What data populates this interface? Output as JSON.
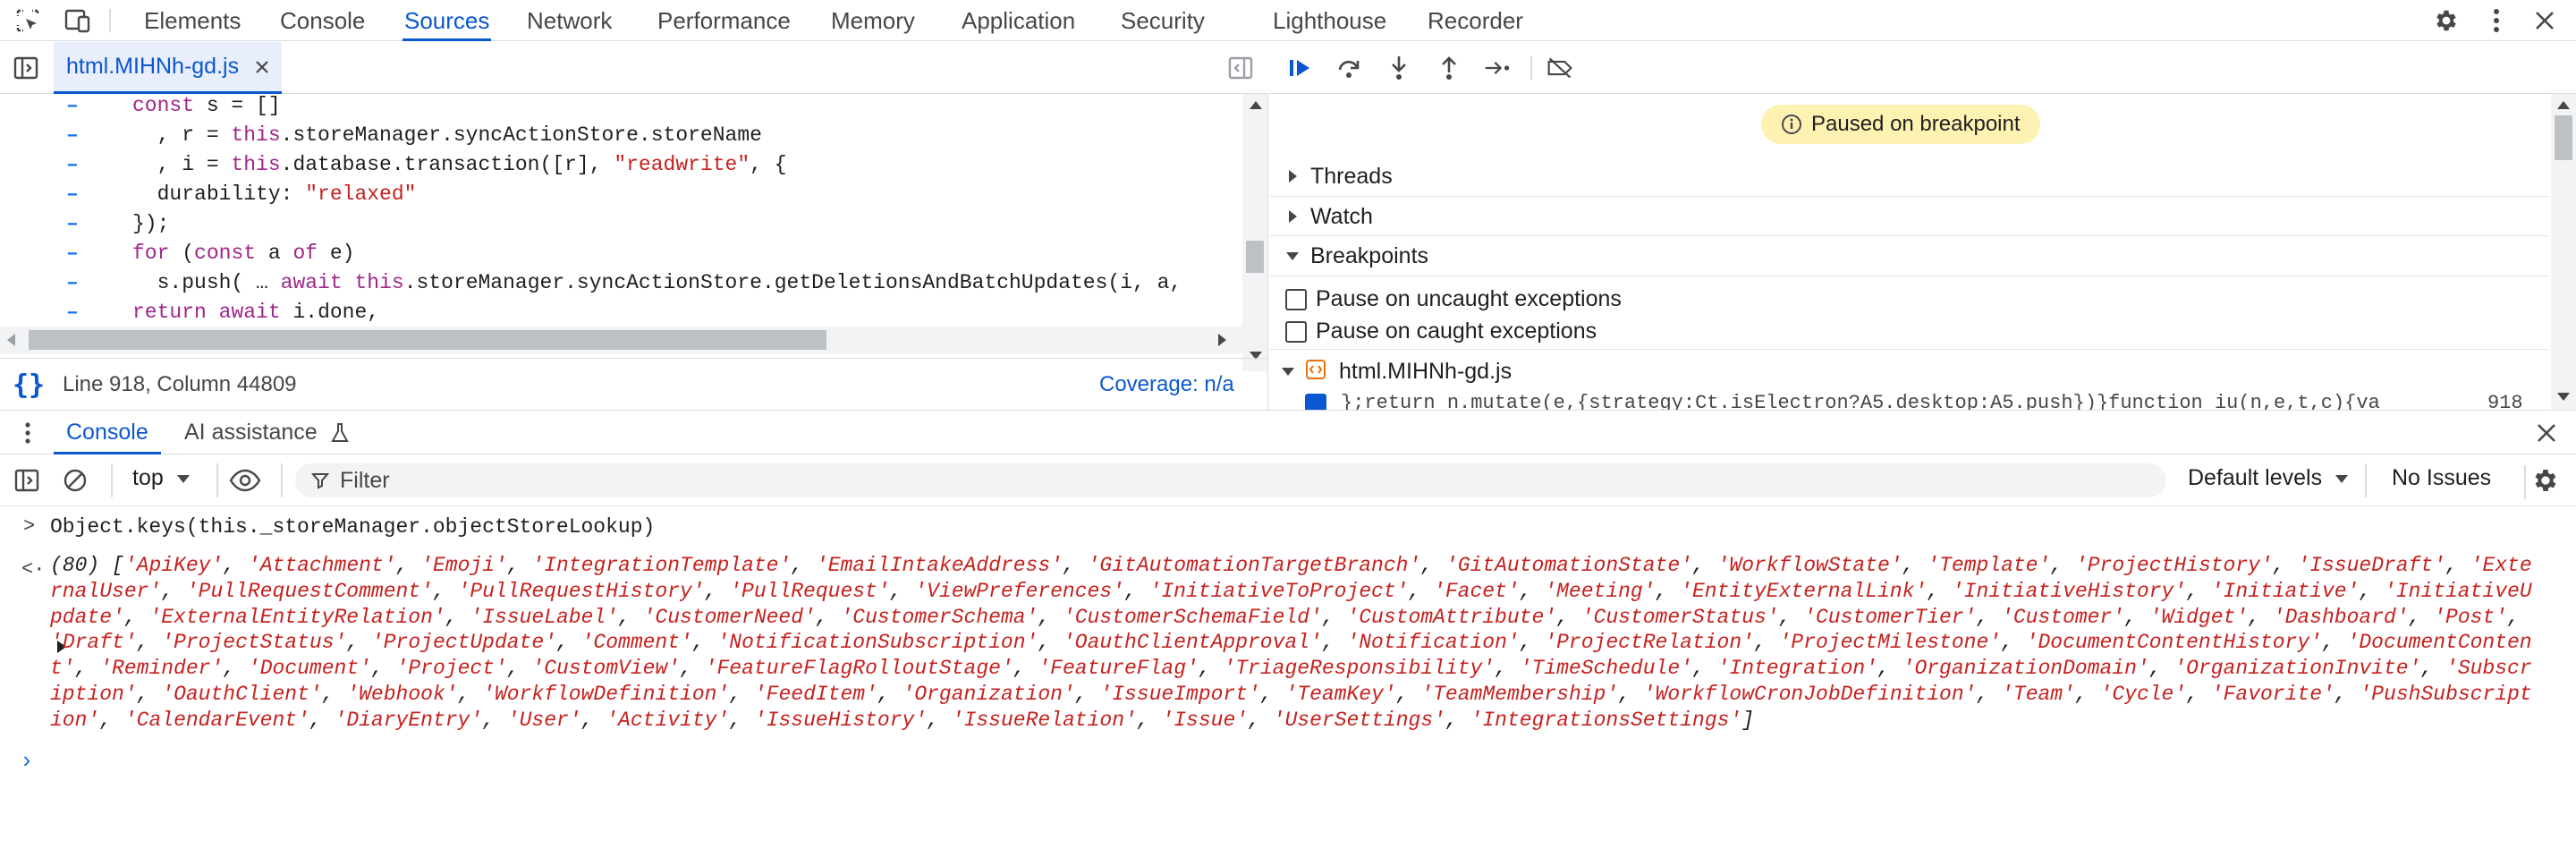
{
  "toolbar": {
    "tabs": [
      "Elements",
      "Console",
      "Sources",
      "Network",
      "Performance",
      "Memory",
      "Application",
      "Security",
      "Lighthouse",
      "Recorder"
    ],
    "active_tab": "Sources"
  },
  "editor": {
    "file_tab": "html.MIHNh-gd.js",
    "lines": [
      {
        "gutter": "–",
        "html": "<span class=\"kw\">const</span> s = []"
      },
      {
        "gutter": "–",
        "html": "  , r = <span class=\"kw\">this</span>.storeManager.syncActionStore.storeName"
      },
      {
        "gutter": "–",
        "html": "  , i = <span class=\"kw\">this</span>.database.transaction([r], <span class=\"st\">\"readwrite\"</span>, {"
      },
      {
        "gutter": "–",
        "html": "  durability: <span class=\"st\">\"relaxed\"</span>"
      },
      {
        "gutter": "–",
        "html": "});"
      },
      {
        "gutter": "–",
        "html": "<span class=\"kw\">for</span> (<span class=\"kw\">const</span> a <span class=\"kw\">of</span> e)"
      },
      {
        "gutter": "–",
        "html": "  s.push( … <span class=\"kw\">await</span> <span class=\"kw\">this</span>.storeManager.syncActionStore.getDeletionsAndBatchUpdates(i, a,"
      },
      {
        "gutter": "–",
        "html": "<span class=\"kw\">return</span> <span class=\"kw\">await</span> i.done,"
      }
    ],
    "status_position": "Line 918, Column 44809",
    "coverage": "Coverage: n/a"
  },
  "debugger": {
    "paused_label": "Paused on breakpoint",
    "threads": "Threads",
    "watch": "Watch",
    "breakpoints": "Breakpoints",
    "pause_uncaught": "Pause on uncaught exceptions",
    "pause_caught": "Pause on caught exceptions",
    "bp_file": "html.MIHNh-gd.js",
    "bp_snippet": "};return n.mutate(e,{strategy:Ct.isElectron?A5.desktop:A5.push})}function iu(n,e,t,c){va",
    "bp_line": "918"
  },
  "drawer": {
    "console_tab": "Console",
    "ai_tab": "AI assistance"
  },
  "console_toolbar": {
    "context": "top",
    "filter_placeholder": "Filter",
    "levels": "Default levels",
    "issues": "No Issues"
  },
  "console": {
    "command": "Object.keys(this._storeManager.objectStoreLookup)",
    "result_count": "(80)",
    "result_items": [
      "ApiKey",
      "Attachment",
      "Emoji",
      "IntegrationTemplate",
      "EmailIntakeAddress",
      "GitAutomationTargetBranch",
      "GitAutomationState",
      "WorkflowState",
      "Template",
      "ProjectHistory",
      "IssueDraft",
      "ExternalUser",
      "PullRequestComment",
      "PullRequestHistory",
      "PullRequest",
      "ViewPreferences",
      "InitiativeToProject",
      "Facet",
      "Meeting",
      "EntityExternalLink",
      "InitiativeHistory",
      "Initiative",
      "InitiativeUpdate",
      "ExternalEntityRelation",
      "IssueLabel",
      "CustomerNeed",
      "CustomerSchema",
      "CustomerSchemaField",
      "CustomAttribute",
      "CustomerStatus",
      "CustomerTier",
      "Customer",
      "Widget",
      "Dashboard",
      "Post",
      "Draft",
      "ProjectStatus",
      "ProjectUpdate",
      "Comment",
      "NotificationSubscription",
      "OauthClientApproval",
      "Notification",
      "ProjectRelation",
      "ProjectMilestone",
      "DocumentContentHistory",
      "DocumentContent",
      "Reminder",
      "Document",
      "Project",
      "CustomView",
      "FeatureFlagRolloutStage",
      "FeatureFlag",
      "TriageResponsibility",
      "TimeSchedule",
      "Integration",
      "OrganizationDomain",
      "OrganizationInvite",
      "Subscription",
      "OauthClient",
      "Webhook",
      "WorkflowDefinition",
      "FeedItem",
      "Organization",
      "IssueImport",
      "TeamKey",
      "TeamMembership",
      "WorkflowCronJobDefinition",
      "Team",
      "Cycle",
      "Favorite",
      "PushSubscription",
      "CalendarEvent",
      "DiaryEntry",
      "User",
      "Activity",
      "IssueHistory",
      "IssueRelation",
      "Issue",
      "UserSettings",
      "IntegrationsSettings"
    ]
  }
}
